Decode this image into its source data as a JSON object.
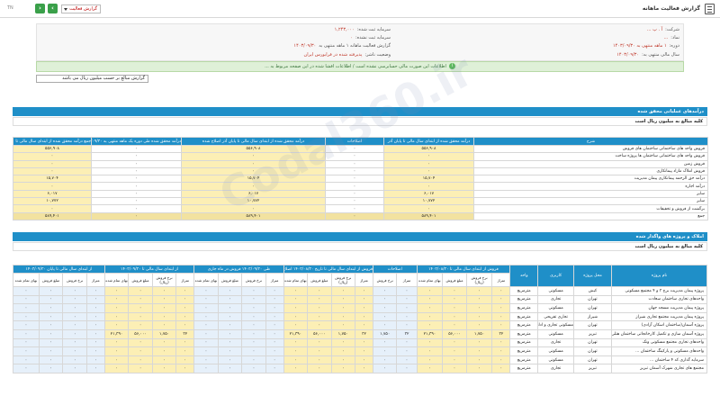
{
  "header": {
    "title": "گزارش فعالیت ماهانه",
    "report_type": "گزارش فعالیت",
    "left_label": "TN"
  },
  "info": {
    "company_k": "شرکت:",
    "company_v": "آ . پ ...",
    "symbol_k": "نماد:",
    "symbol_v": "...",
    "period_k": "دوره:",
    "period_v": "۱ ماهه منتهی به ۱۴۰۳/۰۹/۳۰",
    "fy_k": "سال مالی منتهی به:",
    "fy_v": "۱۴۰۳/۰۹/۳۰",
    "capital_k": "سرمایه ثبت شده:",
    "capital_v": "۱,۲۴۳,۰۰۰",
    "unreg_k": "سرمایه ثبت نشده:",
    "unreg_v": "۰",
    "report_k": "گزارش فعالیت ماهانه ۱ ماهه منتهی به",
    "report_v": "۱۴۰۳/۰۹/۳۰",
    "status_k": "وضعیت ناشر:",
    "status_v": "پذیرفته شده در فرابورس ایران",
    "notice": "اطلاعات این صورت مالی حسابرسی نشده است / اطلاعات افشا شده در این صفحه مربوط به ..."
  },
  "unit_box": "گزارش مبالغ بر حسب میلیون ریال می باشد",
  "section1": {
    "title": "درآمدهای عملیاتی محقق شده",
    "sub": "کلیه مبالغ به میلیون ریال است",
    "headers": [
      "شرح",
      "درآمد محقق شده از ابتدای سال مالی تا پایان آذر",
      "اصلاحات",
      "درآمد محقق شده از ابتدای سال مالی تا پایان آذر اصلاح شده",
      "درآمد محقق شده طی دوره یک ماهه منتهی به ۱۴۰۳/۰۹/۳۰",
      "جمع درآمد محقق شده از ابتدای سال مالی تا ۱۴۰۳/۰۹/۳۰"
    ],
    "rows": [
      [
        "فروش واحد های ساختمانی ساختمان های فروش",
        "۵۵۶,۹۰۸",
        "۰",
        "۵۵۶,۹۰۸",
        "۰",
        "۵۵۶,۹۰۸"
      ],
      [
        "فروش واحد های ساختمانی ساختمان ها پروژه ساخت",
        "۰",
        "۰",
        "۰",
        "۰",
        "۰"
      ],
      [
        "فروش زمین",
        "۰",
        "۰",
        "۰",
        "۰",
        "۰"
      ],
      [
        "فروش املاک مازاد پیمانکاری",
        "۰",
        "۰",
        "۰",
        "۰",
        "۰"
      ],
      [
        "درآمد حق الزحمه پیمانکاری پیمان مدیریت",
        "۱۵,۷۰۴",
        "۰",
        "۱۵,۷۰۴",
        "۰",
        "۱۵,۷۰۴"
      ],
      [
        "درآمد اجاره",
        "۰",
        "۰",
        "۰",
        "۰",
        "۰"
      ],
      [
        "سایر",
        "۶,۰۱۷",
        "۰",
        "۶,۰۱۷",
        "۰",
        "۶,۰۱۷"
      ],
      [
        "سایر",
        "۱۰,۷۷۲",
        "۰",
        "۱۰,۷۷۲",
        "۰",
        "۱۰,۷۷۲"
      ],
      [
        "برگشت از فروش و تخفیفات",
        "۰",
        "۰",
        "۰",
        "۰",
        "۰"
      ],
      [
        "جمع",
        "۵۸۹,۴۰۱",
        "۰",
        "۵۸۹,۴۰۱",
        "۰",
        "۵۸۹,۴۰۱"
      ]
    ]
  },
  "section2": {
    "title": "املاک و پروژه های واگذار شده",
    "sub": "کلیه مبالغ به میلیون ریال است",
    "group_headers": [
      "نام پروژه",
      "محل پروژه",
      "کاربری",
      "واحد",
      "فروش از ابتدای سال مالی تا ۱۴۰۳/۰۸/۳۰",
      "اصلاحات",
      "فروش از ابتدای سال مالی تا تاریخ ۱۴۰۳/۰۸/۳۰ اصلاح شده",
      "طی ۱۴۰۳/۰۹/۳۰ فروش در ماه جاری",
      "از ابتدای سال مالی تا ۱۴۰۳/۰۹/۳۰",
      "از ابتدای سال مالی تا پایان ۱۴۰۳/۰۹/۳۰"
    ],
    "sub_headers": [
      "متراژ",
      "نرخ فروش (ریال)",
      "مبلغ فروش",
      "بهای تمام شده",
      "متراژ",
      "نرخ فروش",
      "مبلغ فروش",
      "بهای تمام شده"
    ],
    "rows": [
      [
        "پروژه پیمان مدیریت برج ۳ و ۴ مجتمع مسکونی",
        "کیش",
        "مسکونی",
        "مترمربع"
      ],
      [
        "واحدهای تجاری ساختمان سعادت",
        "تهران",
        "تجاری",
        "مترمربع"
      ],
      [
        "پروژه پیمان مدیریت مسجد جهان",
        "تهران",
        "مسکونی",
        "مترمربع"
      ],
      [
        "پروژه پیمان مدیریت مجتمع تجاری شیراز",
        "شیراز",
        "تجاری تفریحی",
        "مترمربع"
      ],
      [
        "پروژه آسمان(ساختمان اسکان آزادی)",
        "تهران",
        "مسکونی تجاری و اداری",
        "مترمربع"
      ],
      [
        "پروژه آسمان سازی و تکمیل کارخانجاتی ساختمان هتلی زنجیره",
        "تبریز",
        "مسکونی",
        "مترمربع"
      ],
      [
        "واحدهای تجاری مجتمع مسکونی ونک",
        "تهران",
        "تجاری",
        "مترمربع"
      ],
      [
        "واحدهای مسکونی و پارکینگ ساختمان ...",
        "تهران",
        "مسکونی",
        "مترمربع"
      ],
      [
        "سرمایه گذاری کد ۴ ساختمان ...",
        "تهران",
        "مسکونی",
        "مترمربع"
      ],
      [
        "مجتمع های تجاری شهرک آسمان تبریز",
        "تبریز",
        "تجاری",
        "مترمربع"
      ]
    ],
    "row_values": [
      [
        "۰",
        "۰",
        "۰",
        "۰",
        "۰",
        "۰",
        "۰",
        "۰"
      ],
      [
        "۰",
        "۰",
        "۰",
        "۰",
        "۰",
        "۰",
        "۰",
        "۰"
      ],
      [
        "۰",
        "۰",
        "۰",
        "۰",
        "۰",
        "۰",
        "۰",
        "۰"
      ],
      [
        "۰",
        "۰",
        "۰",
        "۰",
        "۰",
        "۰",
        "۰",
        "۰"
      ],
      [
        "۰",
        "۰",
        "۰",
        "۰",
        "۰",
        "۰",
        "۰",
        "۰"
      ],
      [
        "۳۲",
        "۱,۷۵۰",
        "۵۶,۰۰۰",
        "۲۱,۳۹۰",
        "۰",
        "۰",
        "۰",
        "۰"
      ],
      [
        "۰",
        "۰",
        "۰",
        "۰",
        "۰",
        "۰",
        "۰",
        "۰"
      ],
      [
        "۰",
        "۰",
        "۰",
        "۰",
        "۰",
        "۰",
        "۰",
        "۰"
      ],
      [
        "۰",
        "۰",
        "۰",
        "۰",
        "۰",
        "۰",
        "۰",
        "۰"
      ],
      [
        "۰",
        "۰",
        "۰",
        "۰",
        "۰",
        "۰",
        "۰",
        "۰"
      ]
    ]
  },
  "watermark": "Codal360.ir",
  "colors": {
    "accent": "#1f8fc8",
    "yellow": "#fcefb5",
    "green": "#3aa04a"
  }
}
